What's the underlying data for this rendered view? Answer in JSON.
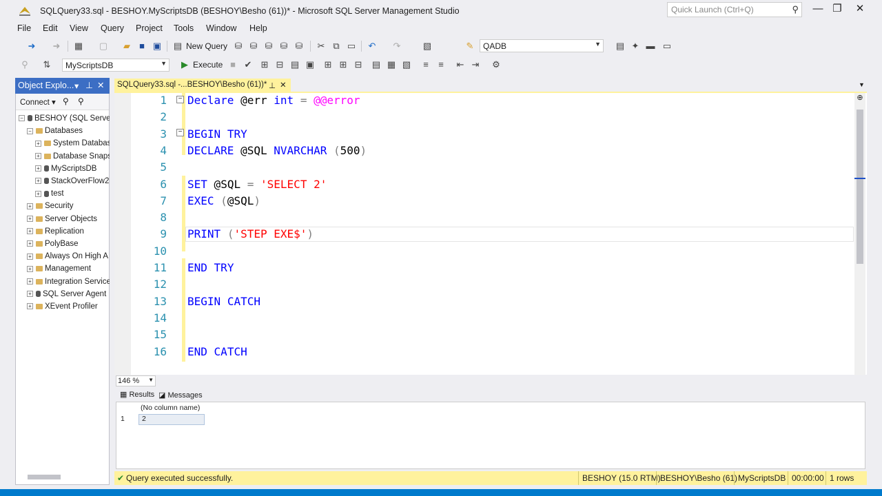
{
  "window": {
    "title": "SQLQuery33.sql - BESHOY.MyScriptsDB (BESHOY\\Besho (61))* - Microsoft SQL Server Management Studio",
    "quick_launch_placeholder": "Quick Launch (Ctrl+Q)"
  },
  "menu": [
    "File",
    "Edit",
    "View",
    "Query",
    "Project",
    "Tools",
    "Window",
    "Help"
  ],
  "toolbar1": {
    "new_query": "New Query",
    "solution_combo": "QADB"
  },
  "toolbar2": {
    "database_combo": "MyScriptsDB",
    "execute": "Execute"
  },
  "object_explorer": {
    "title": "Object Explo...",
    "connect": "Connect",
    "tree": [
      {
        "label": "BESHOY (SQL Server",
        "level": 0,
        "sign": "−",
        "icon": "server-icon"
      },
      {
        "label": "Databases",
        "level": 1,
        "sign": "−",
        "icon": "folder-icon"
      },
      {
        "label": "System Databas",
        "level": 2,
        "sign": "+",
        "icon": "folder-icon"
      },
      {
        "label": "Database Snaps",
        "level": 2,
        "sign": "+",
        "icon": "folder-icon"
      },
      {
        "label": "MyScriptsDB",
        "level": 2,
        "sign": "+",
        "icon": "database-icon"
      },
      {
        "label": "StackOverFlow2",
        "level": 2,
        "sign": "+",
        "icon": "database-icon"
      },
      {
        "label": "test",
        "level": 2,
        "sign": "+",
        "icon": "database-icon"
      },
      {
        "label": "Security",
        "level": 1,
        "sign": "+",
        "icon": "folder-icon"
      },
      {
        "label": "Server Objects",
        "level": 1,
        "sign": "+",
        "icon": "folder-icon"
      },
      {
        "label": "Replication",
        "level": 1,
        "sign": "+",
        "icon": "folder-icon"
      },
      {
        "label": "PolyBase",
        "level": 1,
        "sign": "+",
        "icon": "folder-icon"
      },
      {
        "label": "Always On High A",
        "level": 1,
        "sign": "+",
        "icon": "folder-icon"
      },
      {
        "label": "Management",
        "level": 1,
        "sign": "+",
        "icon": "folder-icon"
      },
      {
        "label": "Integration Service",
        "level": 1,
        "sign": "+",
        "icon": "folder-icon"
      },
      {
        "label": "SQL Server Agent",
        "level": 1,
        "sign": "+",
        "icon": "agent-icon"
      },
      {
        "label": "XEvent Profiler",
        "level": 1,
        "sign": "+",
        "icon": "folder-icon"
      }
    ]
  },
  "doc_tab": {
    "label": "SQLQuery33.sql -...BESHOY\\Besho (61))*"
  },
  "editor": {
    "lines": [
      {
        "n": "1",
        "text": "Declare @err int = @@error"
      },
      {
        "n": "2",
        "text": ""
      },
      {
        "n": "3",
        "text": "BEGIN TRY"
      },
      {
        "n": "4",
        "text": "DECLARE @SQL NVARCHAR (500)"
      },
      {
        "n": "5",
        "text": ""
      },
      {
        "n": "6",
        "text": "SET @SQL = 'SELECT 2'"
      },
      {
        "n": "7",
        "text": "EXEC (@SQL)"
      },
      {
        "n": "8",
        "text": ""
      },
      {
        "n": "9",
        "text": "PRINT ('STEP EXE$')"
      },
      {
        "n": "10",
        "text": ""
      },
      {
        "n": "11",
        "text": "END TRY"
      },
      {
        "n": "12",
        "text": ""
      },
      {
        "n": "13",
        "text": "BEGIN CATCH"
      },
      {
        "n": "14",
        "text": ""
      },
      {
        "n": "15",
        "text": ""
      },
      {
        "n": "16",
        "text": "END CATCH"
      }
    ]
  },
  "zoom": "146 %",
  "results_tabs": {
    "results": "Results",
    "messages": "Messages"
  },
  "results_grid": {
    "header": "(No column name)",
    "row_num": "1",
    "value": "2"
  },
  "status": {
    "message": "Query executed successfully.",
    "server": "BESHOY (15.0 RTM)",
    "user": "BESHOY\\Besho (61)",
    "db": "MyScriptsDB",
    "time": "00:00:00",
    "rows": "1 rows"
  },
  "colors": {
    "accent": "#007acc",
    "tab_yellow": "#fff29d",
    "oe_header": "#3c6ec4"
  }
}
